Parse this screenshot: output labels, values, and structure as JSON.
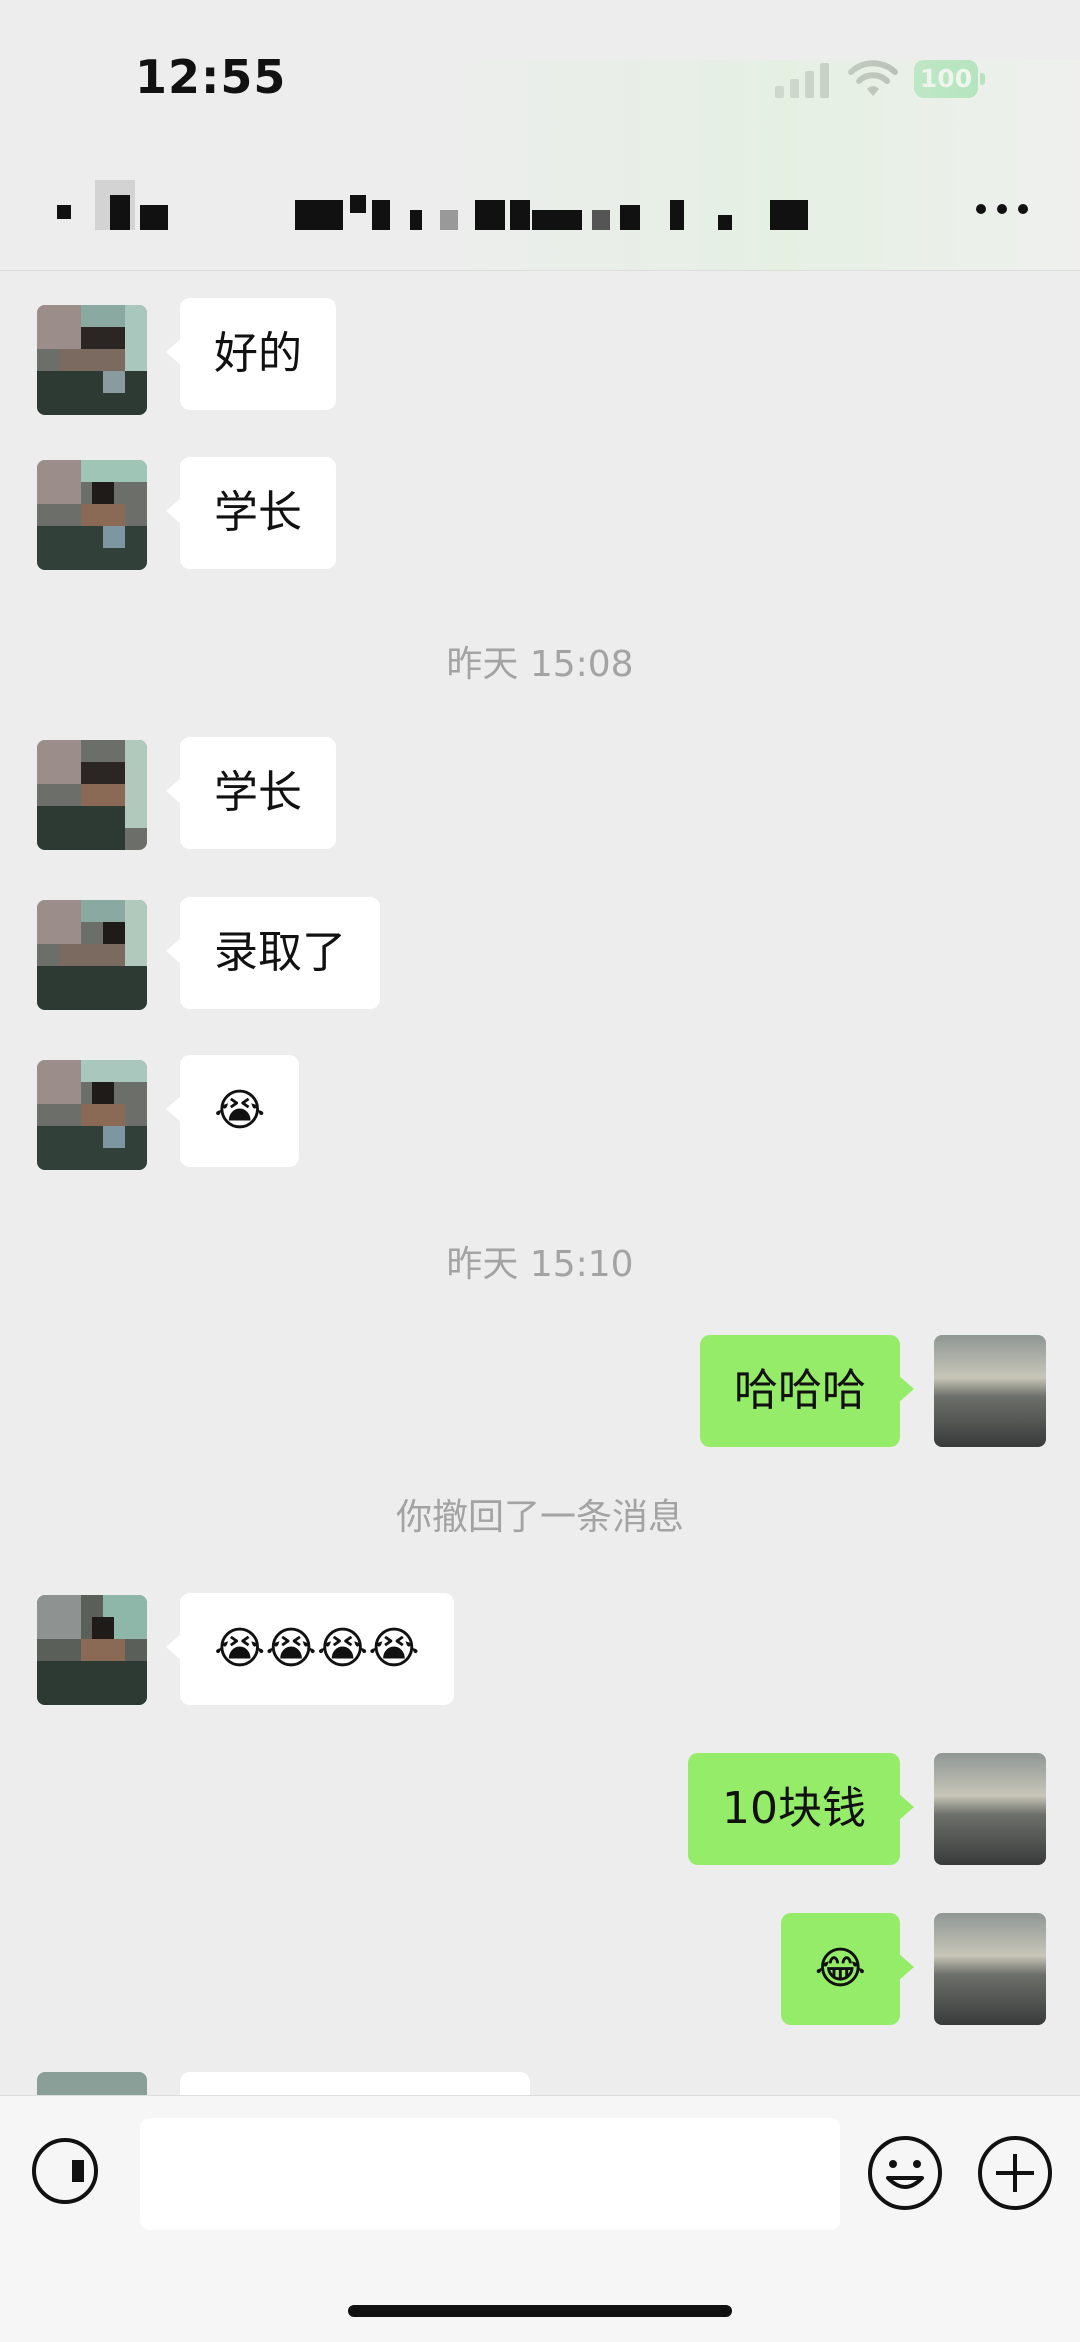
{
  "status_bar": {
    "time": "12:55",
    "battery": "100",
    "battery_color": "#34c759"
  },
  "nav": {
    "more_icon": "more-dots-icon"
  },
  "messages": [
    {
      "side": "in",
      "text": "好的"
    },
    {
      "side": "in",
      "text": "学长"
    },
    {
      "type": "timestamp",
      "text": "昨天 15:08"
    },
    {
      "side": "in",
      "text": "学长"
    },
    {
      "side": "in",
      "text": "录取了"
    },
    {
      "side": "in",
      "text": "😭"
    },
    {
      "type": "timestamp",
      "text": "昨天 15:10"
    },
    {
      "side": "out",
      "text": "哈哈哈"
    },
    {
      "type": "system",
      "text": "你撤回了一条消息"
    },
    {
      "side": "in",
      "text": "😭😭😭😭"
    },
    {
      "side": "out",
      "text": "10块钱"
    },
    {
      "side": "out",
      "text": "😂"
    }
  ],
  "input_bar": {
    "voice_icon": "voice-icon",
    "emoji_icon": "emoji-icon",
    "plus_icon": "plus-icon"
  },
  "colors": {
    "background": "#ededed",
    "incoming_bubble": "#ffffff",
    "outgoing_bubble": "#95ec69",
    "timestamp_text": "#a3a3a3"
  }
}
